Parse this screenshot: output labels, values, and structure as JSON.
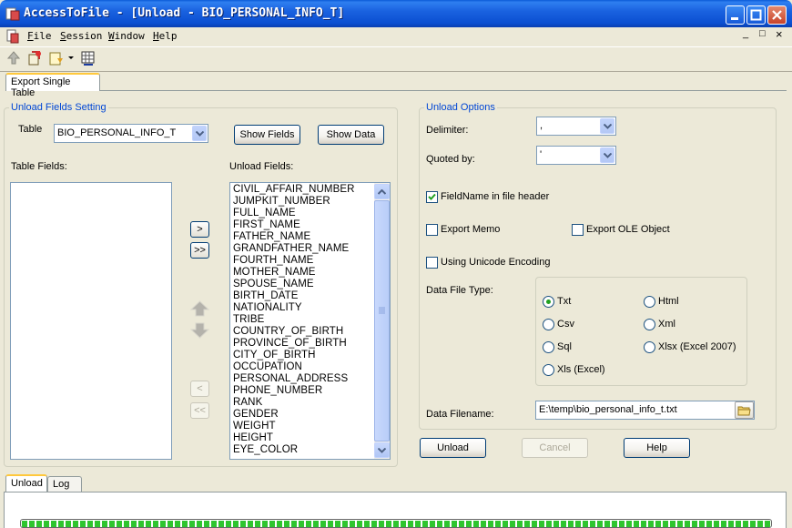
{
  "window": {
    "title": "AccessToFile - [Unload - BIO_PERSONAL_INFO_T]"
  },
  "menu": [
    {
      "u": "F",
      "rest": "ile"
    },
    {
      "u": "S",
      "rest": "ession"
    },
    {
      "u": "W",
      "rest": "indow"
    },
    {
      "u": "H",
      "rest": "elp"
    }
  ],
  "mdi_controls": {
    "minimize": "_",
    "restore": "□",
    "close": "×"
  },
  "top_tab": {
    "label": "Export Single Table"
  },
  "unload_fields": {
    "group_label": "Unload Fields Setting",
    "table_label": "Table",
    "table_value": "BIO_PERSONAL_INFO_T",
    "show_fields": "Show Fields",
    "show_data": "Show Data",
    "table_fields_label": "Table Fields:",
    "unload_fields_label": "Unload Fields:",
    "move_right": ">",
    "move_all_right": ">>",
    "move_left": "<",
    "move_all_left": "<<",
    "fields": [
      "CIVIL_AFFAIR_NUMBER",
      "JUMPKIT_NUMBER",
      "FULL_NAME",
      "FIRST_NAME",
      "FATHER_NAME",
      "GRANDFATHER_NAME",
      "FOURTH_NAME",
      "MOTHER_NAME",
      "SPOUSE_NAME",
      "BIRTH_DATE",
      "NATIONALITY",
      "TRIBE",
      "COUNTRY_OF_BIRTH",
      "PROVINCE_OF_BIRTH",
      "CITY_OF_BIRTH",
      "OCCUPATION",
      "PERSONAL_ADDRESS",
      "PHONE_NUMBER",
      "RANK",
      "GENDER",
      "WEIGHT",
      "HEIGHT",
      "EYE_COLOR"
    ]
  },
  "unload_options": {
    "group_label": "Unload Options",
    "delimiter_label": "Delimiter:",
    "delimiter_value": ",",
    "quoted_label": "Quoted by:",
    "quoted_value": "'",
    "fieldname_header": "FieldName in file header",
    "fieldname_header_checked": true,
    "export_memo": "Export Memo",
    "export_ole": "Export OLE Object",
    "unicode": "Using Unicode Encoding",
    "file_type_label": "Data File Type:",
    "file_types": [
      {
        "label": "Txt",
        "selected": true
      },
      {
        "label": "Html",
        "selected": false
      },
      {
        "label": "Csv",
        "selected": false
      },
      {
        "label": "Xml",
        "selected": false
      },
      {
        "label": "Sql",
        "selected": false
      },
      {
        "label": "Xlsx (Excel 2007)",
        "selected": false
      },
      {
        "label": "Xls (Excel)",
        "selected": false
      }
    ],
    "filename_label": "Data Filename:",
    "filename_value": "E:\\temp\\bio_personal_info_t.txt"
  },
  "actions": {
    "unload": "Unload",
    "cancel": "Cancel",
    "help": "Help"
  },
  "bottom_tabs": [
    {
      "label": "Unload"
    },
    {
      "label": "Log"
    }
  ],
  "progress": {
    "fraction": 1.0
  },
  "colors": {
    "accent_blue": "#0046d5",
    "progress_green": "#2ec52e",
    "title_blue": "#0b4fd1"
  }
}
